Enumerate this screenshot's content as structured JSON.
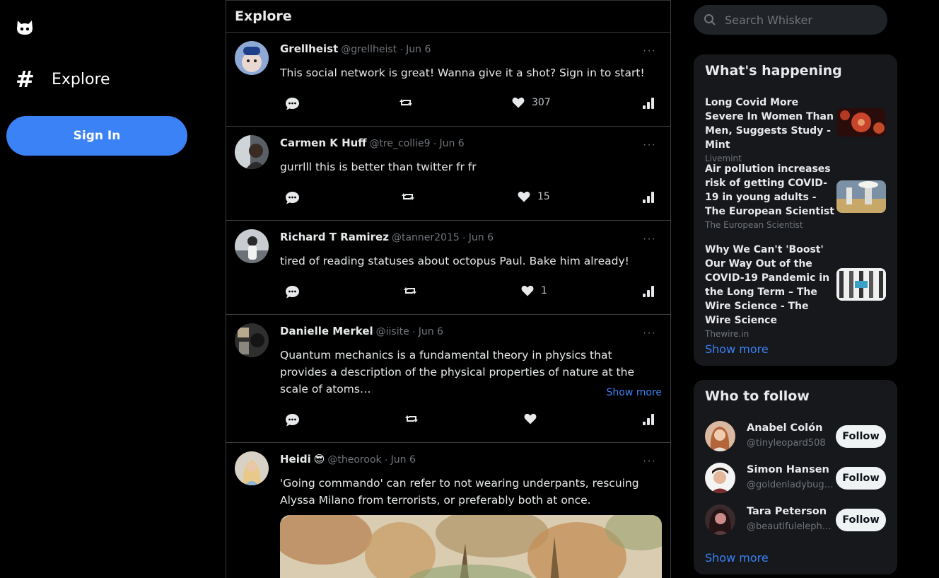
{
  "app": {
    "logo_icon": "cat-logo-icon",
    "nav": {
      "explore_label": "Explore",
      "explore_icon": "hash-icon"
    },
    "signin_label": "Sign In"
  },
  "main": {
    "title": "Explore",
    "posts": [
      {
        "name": "Grellheist",
        "handle": "@grellheist",
        "date": "Jun 6",
        "text": "This social network is great! Wanna give it a shot? Sign in to start!",
        "likes": "307"
      },
      {
        "name": "Carmen K Huff",
        "handle": "@tre_collie9",
        "date": "Jun 6",
        "text": "gurrlll this is better than twitter fr fr",
        "likes": "15"
      },
      {
        "name": "Richard T Ramirez",
        "handle": "@tanner2015",
        "date": "Jun 6",
        "text": "tired of reading statuses about octopus Paul. Bake him already!",
        "likes": "1"
      },
      {
        "name": "Danielle Merkel",
        "handle": "@iisite",
        "date": "Jun 6",
        "text": "Quantum mechanics is a fundamental theory in physics that provides a description of the physical properties of nature at the scale of atoms…",
        "likes": "",
        "show_more": "Show more"
      },
      {
        "name": "Heidi",
        "emoji": "😎",
        "handle": "@theorook",
        "date": "Jun 6",
        "text": "'Going commando' can refer to not wearing underpants, rescuing Alyssa Milano from terrorists, or preferably both at once."
      }
    ]
  },
  "right": {
    "search_placeholder": "Search Whisker",
    "happening": {
      "title": "What's happening",
      "items": [
        {
          "title": "Long Covid More Severe In Women Than Men, Suggests Study - Mint",
          "source": "Livemint"
        },
        {
          "title": "Air pollution increases risk of getting COVID-19 in young adults - The European Scientist",
          "source": "The European Scientist"
        },
        {
          "title": "Why We Can't 'Boost' Our Way Out of the COVID-19 Pandemic in the Long Term – The Wire Science - The Wire Science",
          "source": "Thewire.in"
        }
      ],
      "show_more": "Show more"
    },
    "who_to_follow": {
      "title": "Who to follow",
      "users": [
        {
          "name": "Anabel Colón",
          "handle": "@tinyleopard508",
          "button": "Follow"
        },
        {
          "name": "Simon Hansen",
          "handle": "@goldenladybug5…",
          "button": "Follow"
        },
        {
          "name": "Tara Peterson",
          "handle": "@beautifulelephan…",
          "button": "Follow"
        }
      ],
      "show_more": "Show more"
    }
  }
}
